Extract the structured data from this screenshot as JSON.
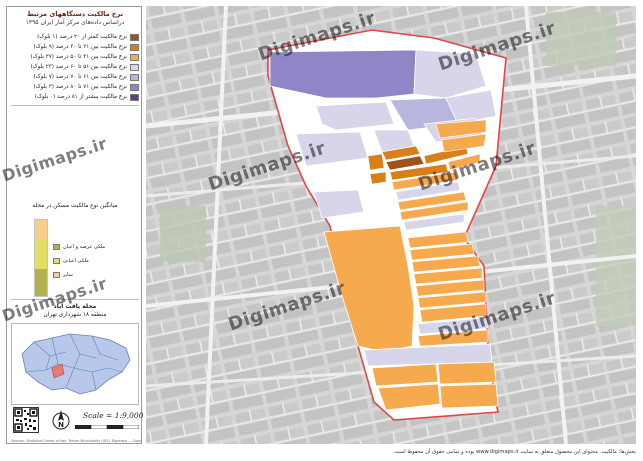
{
  "legend": {
    "title": "نرخ مالکیت دستگاههای مرتبط",
    "subtitle": "دراساس داده‌های مرکز آمار ایران ۱۳۹۵",
    "items": [
      {
        "label": "نرخ مالکیت کمتر از ۲۰ درصد (۱ بلوک)",
        "color": "#a0521c"
      },
      {
        "label": "نرخ مالکیت بین ۲۱ تا ۳۰ درصد (۹ بلوک)",
        "color": "#d87f17"
      },
      {
        "label": "نرخ مالکیت بین ۳۱ تا ۵۰ درصد (۳۷ بلوک)",
        "color": "#f7a94e"
      },
      {
        "label": "نرخ مالکیت بین ۵۱ تا ۶۰ درصد (۲۳ بلوک)",
        "color": "#d7d5ea"
      },
      {
        "label": "نرخ مالکیت بین ۶۱ تا ۷۰ درصد (۷ بلوک)",
        "color": "#b8b6de"
      },
      {
        "label": "نرخ مالکیت بین ۷۱ تا ۸۰ درصد (۳ بلوک)",
        "color": "#8e86c6"
      },
      {
        "label": "نرخ مالکیت بیشتر از ۸۱ درصد (۰ بلوک)",
        "color": "#5c3a8e"
      }
    ]
  },
  "tenure_chart": {
    "title": "میانگین نوع مالکیت مسکن در محله",
    "segments": [
      {
        "label": "ملکی عرصه و اعیان",
        "color": "#b3b14e",
        "value": 0.35
      },
      {
        "label": "ملکی اعیانی",
        "color": "#e3de60",
        "value": 0.4
      },
      {
        "label": "سایر",
        "color": "#f7cf8a",
        "value": 0.25
      }
    ]
  },
  "location": {
    "neighborhood": "محله یافت آباد",
    "district": "منطقه ۱۸ شهرداری تهران"
  },
  "scale_text": "Scale = 1:9,000",
  "watermark": "Digimaps.ir",
  "credit_line": "Sources: Statistical Center of Iran, Tehran Municipality (GIS), Digimaps — Coordinate System: UTM",
  "footer_text": "بخش‌ها: مالکیت. محتوای این محصول متعلق به سایت www.digimaps.ir بوده و تمامی حقوق آن محفوظ است."
}
